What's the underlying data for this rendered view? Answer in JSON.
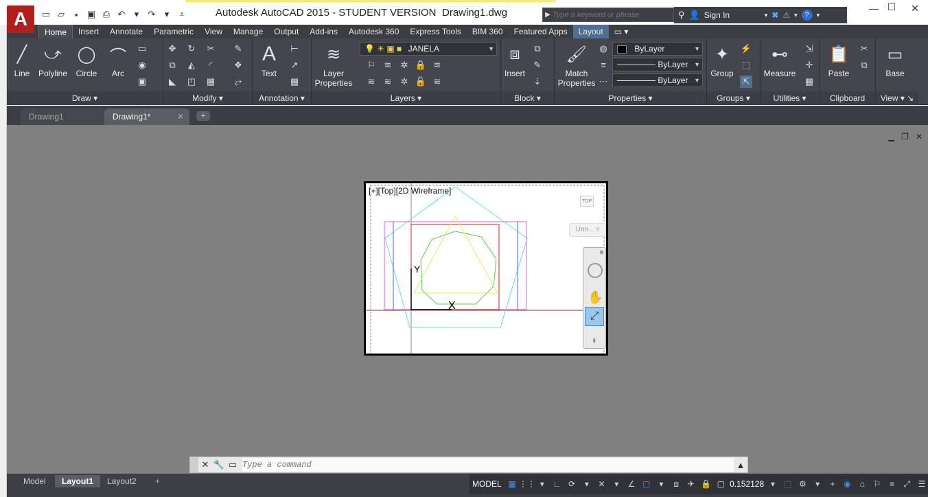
{
  "title": {
    "app": "Autodesk AutoCAD 2015 - STUDENT VERSION",
    "file": "Drawing1.dwg",
    "search_placeholder": "Type a keyword or phrase",
    "sign_in": "Sign In"
  },
  "ribbon_tabs": [
    "Home",
    "Insert",
    "Annotate",
    "Parametric",
    "View",
    "Manage",
    "Output",
    "Add-ins",
    "Autodesk 360",
    "Express Tools",
    "BIM 360",
    "Featured Apps",
    "Layout"
  ],
  "ribbon": {
    "draw": {
      "title": "Draw",
      "buttons": [
        "Line",
        "Polyline",
        "Circle",
        "Arc"
      ]
    },
    "modify": {
      "title": "Modify"
    },
    "annotation": {
      "title": "Annotation",
      "text": "Text"
    },
    "layers": {
      "title": "Layers",
      "layer_props": "Layer\nProperties",
      "layer_props_l1": "Layer",
      "layer_props_l2": "Properties",
      "current_layer": "JANELA"
    },
    "block": {
      "title": "Block",
      "insert": "Insert"
    },
    "properties": {
      "title": "Properties",
      "match_l1": "Match",
      "match_l2": "Properties",
      "color": "ByLayer",
      "linetype": "ByLayer",
      "lineweight": "ByLayer"
    },
    "groups": {
      "title": "Groups",
      "group": "Group"
    },
    "utilities": {
      "title": "Utilities",
      "measure": "Measure"
    },
    "clipboard": {
      "title": "Clipboard",
      "paste": "Paste"
    },
    "view": {
      "title": "View",
      "base": "Base"
    }
  },
  "file_tabs": [
    "Drawing1",
    "Drawing1*"
  ],
  "viewport": {
    "label": "[+][Top][2D Wireframe]",
    "viewcube_label": "Unn...",
    "top_label": "TOP"
  },
  "command": {
    "placeholder": "Type a command"
  },
  "layout_tabs": [
    "Model",
    "Layout1",
    "Layout2"
  ],
  "status": {
    "model": "MODEL",
    "scale": "0.152128"
  },
  "colors": {
    "ribbon_bg": "#43464c",
    "canvas_bg": "#808080",
    "accent": "#b01e1e"
  }
}
